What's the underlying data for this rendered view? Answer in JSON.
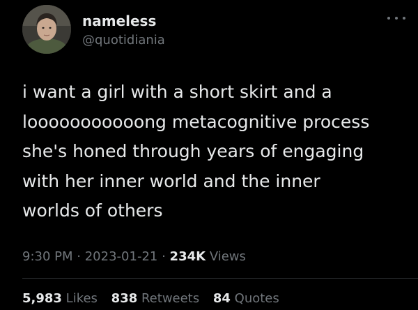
{
  "author": {
    "display_name": "nameless",
    "handle": "@quotidiania",
    "avatar_icon": "profile-photo"
  },
  "more_icon": "more-dots-icon",
  "tweet": {
    "lines": [
      "i want a girl with a short skirt and a",
      "looooooooooong metacognitive process",
      "she's honed through years of engaging",
      "with her inner world and the inner",
      "worlds of others"
    ]
  },
  "meta": {
    "time": "9:30 PM",
    "separator": "·",
    "date": "2023-01-21",
    "views_count": "234K",
    "views_label": "Views"
  },
  "stats": {
    "likes_count": "5,983",
    "likes_label": "Likes",
    "retweets_count": "838",
    "retweets_label": "Retweets",
    "quotes_count": "84",
    "quotes_label": "Quotes"
  },
  "colors": {
    "background": "#000000",
    "primary_text": "#e7e9ea",
    "secondary_text": "#71767b",
    "divider": "#2f3336"
  }
}
